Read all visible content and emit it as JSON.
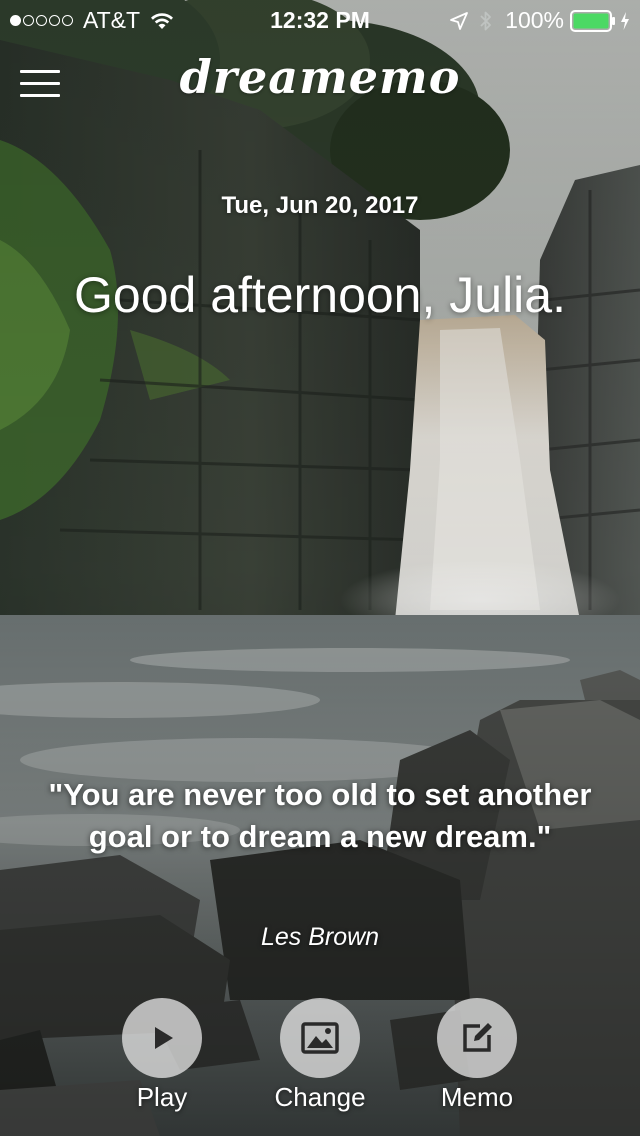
{
  "status_bar": {
    "carrier": "AT&T",
    "signal_bars_filled": 1,
    "signal_bars_total": 5,
    "time": "12:32 PM",
    "battery_percent": "100%",
    "battery_color": "#4cd964"
  },
  "header": {
    "app_name": "dreamemo",
    "menu_icon": "hamburger-menu-icon"
  },
  "main": {
    "date": "Tue, Jun 20, 2017",
    "greeting": "Good afternoon, Julia."
  },
  "quote": {
    "text": "\"You are never too old to set another goal or to dream a new dream.\"",
    "author": "Les Brown"
  },
  "actions": [
    {
      "label": "Play",
      "icon": "play-icon"
    },
    {
      "label": "Change",
      "icon": "image-icon"
    },
    {
      "label": "Memo",
      "icon": "edit-icon"
    }
  ],
  "background": {
    "description_icon": "waterfall-photo"
  }
}
